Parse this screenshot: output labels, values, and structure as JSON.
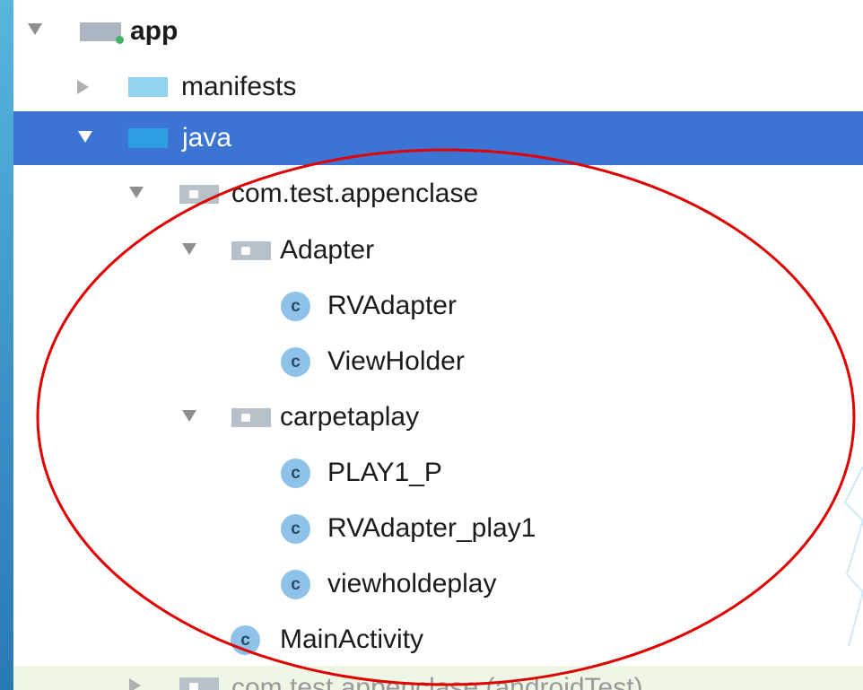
{
  "tree": {
    "module": {
      "label": "app"
    },
    "manifests": {
      "label": "manifests"
    },
    "java": {
      "label": "java"
    },
    "package": {
      "label": "com.test.appenclase"
    },
    "adapter_folder": {
      "label": "Adapter"
    },
    "adapter_children": [
      "RVAdapter",
      "ViewHolder"
    ],
    "carpeta_folder": {
      "label": "carpetaplay"
    },
    "carpeta_children": [
      "PLAY1_P",
      "RVAdapter_play1",
      "viewholdeplay"
    ],
    "main_activity": {
      "label": "MainActivity"
    },
    "partial_row": {
      "label": "com.test.appenclase (androidTest)"
    },
    "class_glyph": "c"
  },
  "colors": {
    "selection": "#3c74d4",
    "annotation": "#e00000",
    "java_folder": "#2b9fe0"
  }
}
